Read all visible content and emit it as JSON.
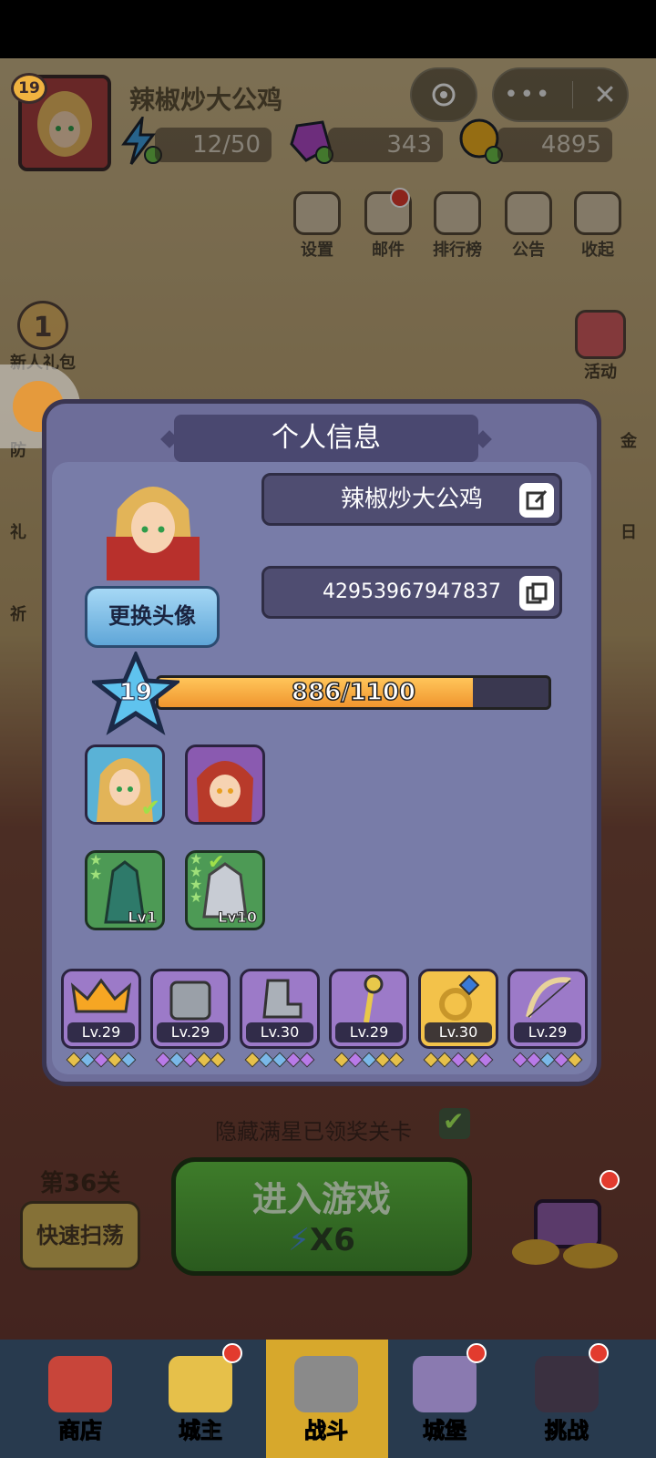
{
  "header": {
    "level": "19",
    "player_name": "辣椒炒大公鸡",
    "energy": "12/50",
    "gems": "343",
    "coins": "4895",
    "menu": [
      {
        "label": "设置",
        "icon": "gear-icon"
      },
      {
        "label": "邮件",
        "icon": "mail-icon"
      },
      {
        "label": "排行榜",
        "icon": "leaderboard-icon"
      },
      {
        "label": "公告",
        "icon": "megaphone-icon"
      },
      {
        "label": "收起",
        "icon": "play-icon"
      }
    ]
  },
  "side": {
    "left": [
      "新人礼包",
      "防",
      "礼",
      "祈"
    ],
    "right": [
      "活动",
      "金",
      "日"
    ],
    "newbie_count": "1"
  },
  "dialog": {
    "title": "个人信息",
    "name_value": "辣椒炒大公鸡",
    "id_value": "42953967947837",
    "change_avatar": "更换头像",
    "level": "19",
    "xp_text": "886/1100",
    "xp_progress": 0.8055,
    "pets": [
      {
        "level": "Lv1"
      },
      {
        "level": "Lv10"
      }
    ],
    "equipment": [
      {
        "name": "crown",
        "level": "Lv.29"
      },
      {
        "name": "armor",
        "level": "Lv.29"
      },
      {
        "name": "boots",
        "level": "Lv.30"
      },
      {
        "name": "staff",
        "level": "Lv.29"
      },
      {
        "name": "ring",
        "level": "Lv.30"
      },
      {
        "name": "bow",
        "level": "Lv.29"
      }
    ]
  },
  "bottom": {
    "hide_text": "隐藏满星已领奖关卡",
    "stage": "第36关",
    "sweep": "快速扫荡",
    "play": "进入游戏",
    "play_cost": "X6"
  },
  "nav": [
    "商店",
    "城主",
    "战斗",
    "城堡",
    "挑战"
  ],
  "colors": {
    "accent": "#f0962e",
    "dialog_bg": "#787ca8",
    "nav_bg": "#283a4e",
    "active_tab": "#d7a82c"
  }
}
